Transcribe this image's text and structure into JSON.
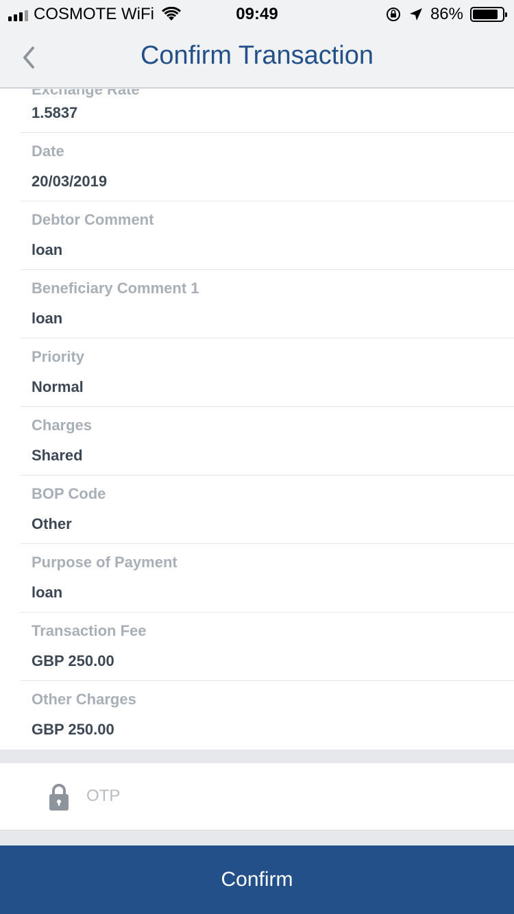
{
  "status_bar": {
    "carrier": "COSMOTE WiFi",
    "time": "09:49",
    "battery": "86%",
    "battery_level": 0.86
  },
  "header": {
    "title": "Confirm Transaction",
    "back_icon": "chevron-left-icon"
  },
  "details": [
    {
      "label": "Exchange Rate",
      "value": "1.5837"
    },
    {
      "label": "Date",
      "value": "20/03/2019"
    },
    {
      "label": "Debtor Comment",
      "value": "loan"
    },
    {
      "label": "Beneficiary Comment 1",
      "value": "loan"
    },
    {
      "label": "Priority",
      "value": "Normal"
    },
    {
      "label": "Charges",
      "value": "Shared"
    },
    {
      "label": "BOP Code",
      "value": "Other"
    },
    {
      "label": "Purpose of Payment",
      "value": "loan"
    },
    {
      "label": "Transaction Fee",
      "value": "GBP 250.00"
    },
    {
      "label": "Other Charges",
      "value": "GBP 250.00"
    }
  ],
  "otp": {
    "placeholder": "OTP",
    "value": "",
    "icon": "lock-icon"
  },
  "footer": {
    "confirm_label": "Confirm"
  },
  "colors": {
    "brand": "#24508a",
    "label": "#a9afb7",
    "value": "#3d4855"
  }
}
